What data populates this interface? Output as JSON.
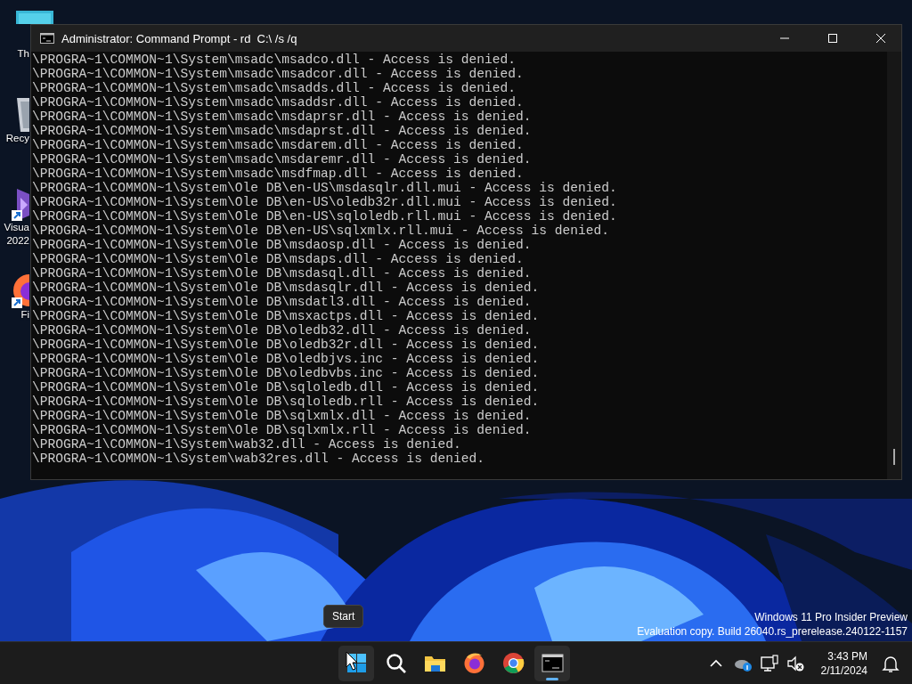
{
  "desktop": {
    "icons": [
      {
        "kind": "computer",
        "label": [
          "Th"
        ]
      },
      {
        "kind": "recycle-bin",
        "label": [
          "Recy"
        ]
      },
      {
        "kind": "visual-studio",
        "label": [
          "Visua",
          "2022"
        ]
      },
      {
        "kind": "firefox",
        "label": [
          "Fi"
        ]
      }
    ]
  },
  "window": {
    "title": "Administrator: Command Prompt - rd  C:\\ /s /q",
    "lines": [
      "\\PROGRA~1\\COMMON~1\\System\\msadc\\msadco.dll - Access is denied.",
      "\\PROGRA~1\\COMMON~1\\System\\msadc\\msadcor.dll - Access is denied.",
      "\\PROGRA~1\\COMMON~1\\System\\msadc\\msadds.dll - Access is denied.",
      "\\PROGRA~1\\COMMON~1\\System\\msadc\\msaddsr.dll - Access is denied.",
      "\\PROGRA~1\\COMMON~1\\System\\msadc\\msdaprsr.dll - Access is denied.",
      "\\PROGRA~1\\COMMON~1\\System\\msadc\\msdaprst.dll - Access is denied.",
      "\\PROGRA~1\\COMMON~1\\System\\msadc\\msdarem.dll - Access is denied.",
      "\\PROGRA~1\\COMMON~1\\System\\msadc\\msdaremr.dll - Access is denied.",
      "\\PROGRA~1\\COMMON~1\\System\\msadc\\msdfmap.dll - Access is denied.",
      "\\PROGRA~1\\COMMON~1\\System\\Ole DB\\en-US\\msdasqlr.dll.mui - Access is denied.",
      "\\PROGRA~1\\COMMON~1\\System\\Ole DB\\en-US\\oledb32r.dll.mui - Access is denied.",
      "\\PROGRA~1\\COMMON~1\\System\\Ole DB\\en-US\\sqloledb.rll.mui - Access is denied.",
      "\\PROGRA~1\\COMMON~1\\System\\Ole DB\\en-US\\sqlxmlx.rll.mui - Access is denied.",
      "\\PROGRA~1\\COMMON~1\\System\\Ole DB\\msdaosp.dll - Access is denied.",
      "\\PROGRA~1\\COMMON~1\\System\\Ole DB\\msdaps.dll - Access is denied.",
      "\\PROGRA~1\\COMMON~1\\System\\Ole DB\\msdasql.dll - Access is denied.",
      "\\PROGRA~1\\COMMON~1\\System\\Ole DB\\msdasqlr.dll - Access is denied.",
      "\\PROGRA~1\\COMMON~1\\System\\Ole DB\\msdatl3.dll - Access is denied.",
      "\\PROGRA~1\\COMMON~1\\System\\Ole DB\\msxactps.dll - Access is denied.",
      "\\PROGRA~1\\COMMON~1\\System\\Ole DB\\oledb32.dll - Access is denied.",
      "\\PROGRA~1\\COMMON~1\\System\\Ole DB\\oledb32r.dll - Access is denied.",
      "\\PROGRA~1\\COMMON~1\\System\\Ole DB\\oledbjvs.inc - Access is denied.",
      "\\PROGRA~1\\COMMON~1\\System\\Ole DB\\oledbvbs.inc - Access is denied.",
      "\\PROGRA~1\\COMMON~1\\System\\Ole DB\\sqloledb.dll - Access is denied.",
      "\\PROGRA~1\\COMMON~1\\System\\Ole DB\\sqloledb.rll - Access is denied.",
      "\\PROGRA~1\\COMMON~1\\System\\Ole DB\\sqlxmlx.dll - Access is denied.",
      "\\PROGRA~1\\COMMON~1\\System\\Ole DB\\sqlxmlx.rll - Access is denied.",
      "\\PROGRA~1\\COMMON~1\\System\\wab32.dll - Access is denied.",
      "\\PROGRA~1\\COMMON~1\\System\\wab32res.dll - Access is denied."
    ]
  },
  "watermark": [
    "Windows 11 Pro Insider Preview",
    "Evaluation copy. Build 26040.rs_prerelease.240122-1157"
  ],
  "tooltip": "Start",
  "taskbar": {
    "apps": [
      {
        "kind": "start",
        "hovered": true,
        "running": false
      },
      {
        "kind": "search",
        "hovered": false,
        "running": false
      },
      {
        "kind": "explorer",
        "hovered": false,
        "running": false
      },
      {
        "kind": "firefox",
        "hovered": false,
        "running": false
      },
      {
        "kind": "chrome",
        "hovered": false,
        "running": false
      },
      {
        "kind": "terminal",
        "hovered": false,
        "running": true
      }
    ],
    "tray": [
      {
        "kind": "chevron"
      },
      {
        "kind": "onedrive"
      },
      {
        "kind": "network"
      },
      {
        "kind": "volume-muted"
      }
    ],
    "time": "3:43 PM",
    "date": "2/11/2024"
  }
}
